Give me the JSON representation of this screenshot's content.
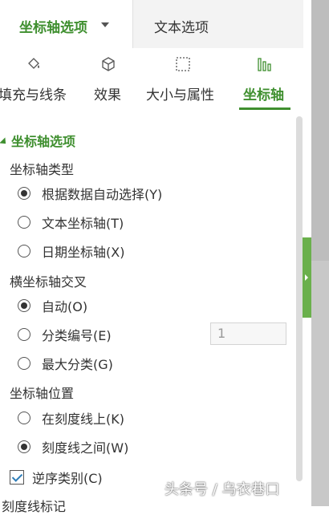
{
  "tabs": {
    "active": "坐标轴选项",
    "other": "文本选项"
  },
  "icon_tabs": [
    {
      "label": "填充与线条",
      "icon": "paint-bucket-icon"
    },
    {
      "label": "效果",
      "icon": "cube-icon"
    },
    {
      "label": "大小与属性",
      "icon": "size-box-icon"
    },
    {
      "label": "坐标轴",
      "icon": "bar-chart-icon"
    }
  ],
  "section": {
    "title": "坐标轴选项"
  },
  "axis_type": {
    "label": "坐标轴类型",
    "options": [
      "根据数据自动选择(Y)",
      "文本坐标轴(T)",
      "日期坐标轴(X)"
    ],
    "selected": 0
  },
  "cross": {
    "label": "横坐标轴交叉",
    "options": [
      "自动(O)",
      "分类编号(E)",
      "最大分类(G)"
    ],
    "selected": 0,
    "category_number": "1"
  },
  "position": {
    "label": "坐标轴位置",
    "options": [
      "在刻度线上(K)",
      "刻度线之间(W)"
    ],
    "selected": 1
  },
  "reverse": {
    "label": "逆序类别(C)",
    "checked": true
  },
  "next_section": "刻度线标记",
  "watermark": "头条号 / 乌衣巷口",
  "colors": {
    "accent": "#3f8f2f"
  }
}
